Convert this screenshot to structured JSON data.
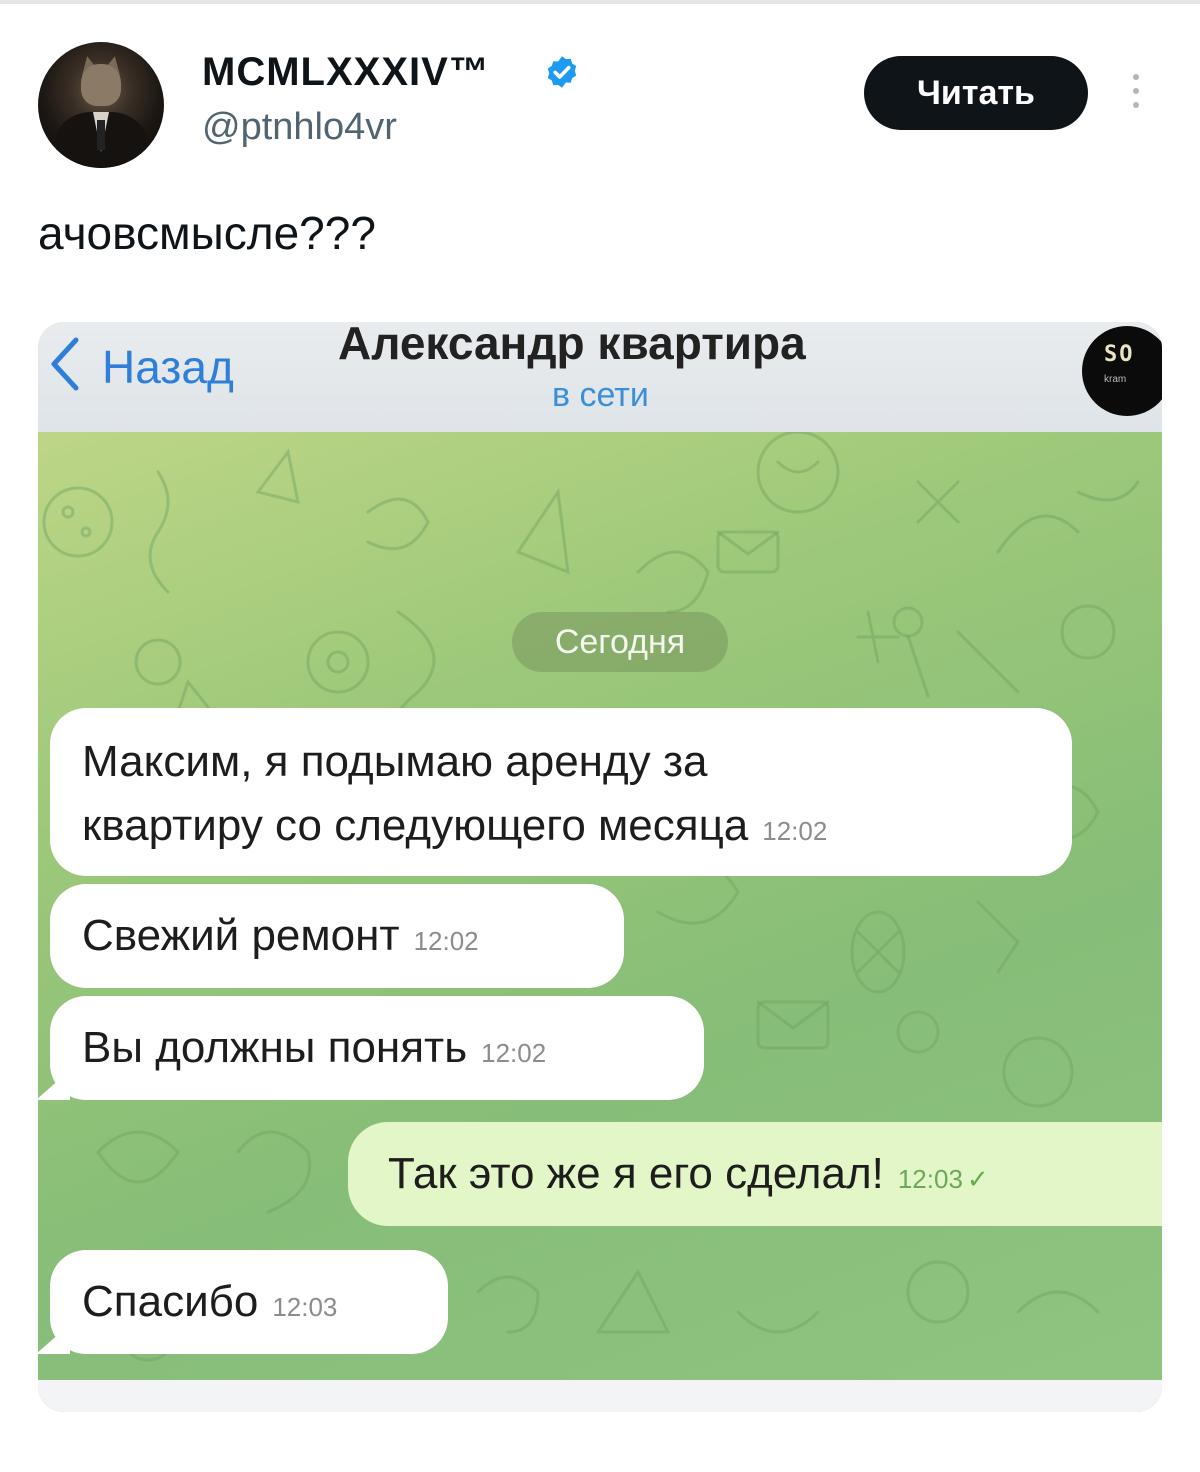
{
  "tweet": {
    "display_name": "MCMLXXXIV™",
    "handle": "@ptnhlo4vr",
    "follow_label": "Читать",
    "text": "ачовсмысле???"
  },
  "chat": {
    "back_label": "Назад",
    "title": "Александр квартира",
    "status": "в сети",
    "avatar_text": "SO",
    "avatar_subtext": "kram",
    "date_label": "Сегодня",
    "messages": [
      {
        "direction": "in",
        "text_line1": "Максим, я подымаю аренду за",
        "text_line2": "квартиру со следующего месяца",
        "time": "12:02"
      },
      {
        "direction": "in",
        "text": "Свежий ремонт",
        "time": "12:02"
      },
      {
        "direction": "in",
        "text": "Вы должны понять",
        "time": "12:02"
      },
      {
        "direction": "out",
        "text": "Так это же я его сделал!",
        "time": "12:03"
      },
      {
        "direction": "in",
        "text": "Спасибо",
        "time": "12:03"
      }
    ]
  },
  "colors": {
    "verified_badge": "#1d9bf0",
    "follow_button_bg": "#0f1419",
    "chat_link": "#2f7fd8",
    "outgoing_bubble": "#e3f6c7"
  },
  "icons": {
    "verified": "verified-badge-icon",
    "more": "more-vertical-icon",
    "back": "chevron-left-icon",
    "read": "double-check-icon"
  }
}
